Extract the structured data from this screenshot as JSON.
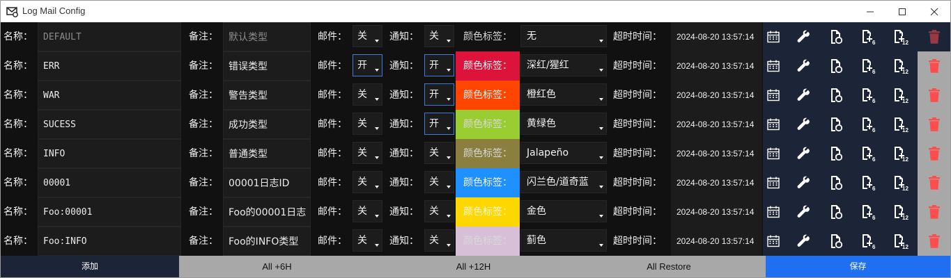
{
  "window": {
    "title": "Log Mail Config"
  },
  "labels": {
    "name": "名称：",
    "remark": "备注：",
    "mail": "邮件：",
    "notify": "通知：",
    "color_tag": "颜色标签：",
    "timeout": "超时时间："
  },
  "rows": [
    {
      "name": "DEFAULT",
      "remark": "默认类型",
      "mail": "关",
      "notify": "关",
      "color_hex": "#121212",
      "color_name": "无",
      "timeout": "2024-08-20 13:57:14"
    },
    {
      "name": "ERR",
      "remark": "错误类型",
      "mail": "开",
      "notify": "开",
      "color_hex": "#dc143c",
      "color_name": "深红/猩红",
      "timeout": "2024-08-20 13:57:14"
    },
    {
      "name": "WAR",
      "remark": "警告类型",
      "mail": "关",
      "notify": "开",
      "color_hex": "#ff4500",
      "color_name": "橙红色",
      "timeout": "2024-08-20 13:57:14"
    },
    {
      "name": "SUCESS",
      "remark": "成功类型",
      "mail": "关",
      "notify": "开",
      "color_hex": "#9acd32",
      "color_name": "黄绿色",
      "timeout": "2024-08-20 13:57:14"
    },
    {
      "name": "INFO",
      "remark": "普通类型",
      "mail": "关",
      "notify": "关",
      "color_hex": "#8a7f3e",
      "color_name": "Jalapeño",
      "timeout": "2024-08-20 13:57:14"
    },
    {
      "name": "00001",
      "remark": "00001日志ID",
      "mail": "关",
      "notify": "关",
      "color_hex": "#1e90ff",
      "color_name": "闪兰色/道奇蓝",
      "timeout": "2024-08-20 13:57:14"
    },
    {
      "name": "Foo:00001",
      "remark": "Foo的00001日志",
      "mail": "关",
      "notify": "关",
      "color_hex": "#ffd700",
      "color_name": "金色",
      "timeout": "2024-08-20 13:57:14"
    },
    {
      "name": "Foo:INFO",
      "remark": "Foo的INFO类型",
      "mail": "关",
      "notify": "关",
      "color_hex": "#d8bfd8",
      "color_name": "蓟色",
      "timeout": "2024-08-20 13:57:14"
    }
  ],
  "row_actions": [
    "calendar-icon",
    "wrench-icon",
    "file-restore-icon",
    "add-6h-icon",
    "add-12h-icon",
    "trash-icon"
  ],
  "footer": {
    "add": "添加",
    "all_6h": "All +6H",
    "all_12h": "All +12H",
    "all_restore": "All Restore",
    "save": "保存"
  },
  "colors": {
    "action_panel": "#1c2438",
    "save": "#1f6ff0",
    "delete_icon": "#ff4d4d",
    "focus_border": "#3d7be0"
  }
}
